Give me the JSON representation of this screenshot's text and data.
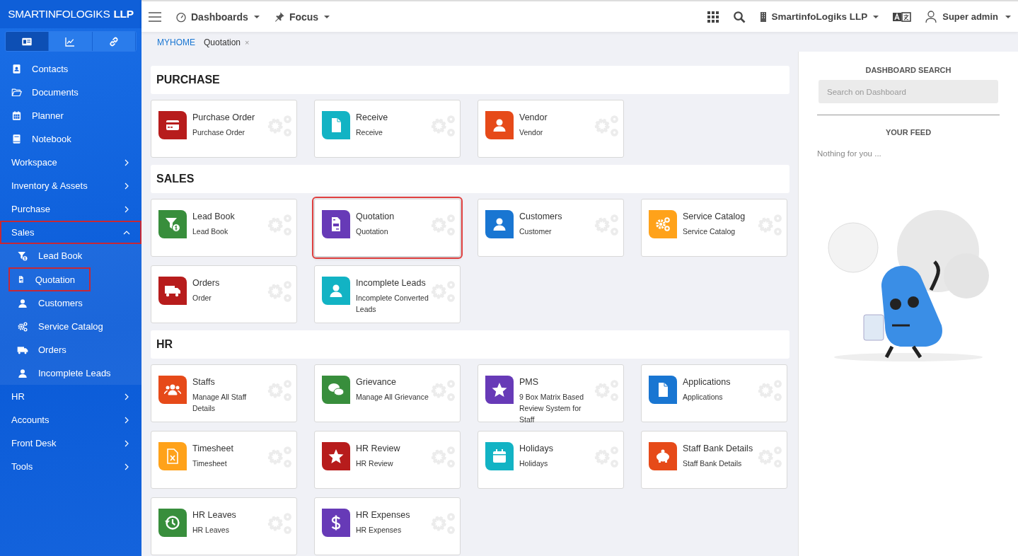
{
  "sidebar": {
    "brand": {
      "name": "SMARTINFOLOGIKS",
      "suffix": "LLP"
    },
    "tabs": [
      {
        "selected": true
      },
      {
        "selected": false
      },
      {
        "selected": false
      }
    ],
    "items": [
      {
        "kind": "link",
        "label": "Contacts"
      },
      {
        "kind": "link",
        "label": "Documents"
      },
      {
        "kind": "link",
        "label": "Planner"
      },
      {
        "kind": "link",
        "label": "Notebook"
      },
      {
        "kind": "group",
        "label": "Workspace",
        "expanded": false,
        "highlighted": false
      },
      {
        "kind": "group",
        "label": "Inventory & Assets",
        "expanded": false,
        "highlighted": false
      },
      {
        "kind": "group",
        "label": "Purchase",
        "expanded": false,
        "highlighted": false
      },
      {
        "kind": "group",
        "label": "Sales",
        "expanded": true,
        "highlighted": true,
        "children": [
          {
            "label": "Lead Book",
            "highlighted": false
          },
          {
            "label": "Quotation",
            "highlighted": true
          },
          {
            "label": "Customers",
            "highlighted": false
          },
          {
            "label": "Service Catalog",
            "highlighted": false
          },
          {
            "label": "Orders",
            "highlighted": false
          },
          {
            "label": "Incomplete Leads",
            "highlighted": false
          }
        ]
      },
      {
        "kind": "group",
        "label": "HR",
        "expanded": false,
        "highlighted": false
      },
      {
        "kind": "group",
        "label": "Accounts",
        "expanded": false,
        "highlighted": false
      },
      {
        "kind": "group",
        "label": "Front Desk",
        "expanded": false,
        "highlighted": false
      },
      {
        "kind": "group",
        "label": "Tools",
        "expanded": false,
        "highlighted": false
      }
    ]
  },
  "topbar": {
    "menus": [
      {
        "label": "Dashboards"
      },
      {
        "label": "Focus"
      }
    ],
    "company": "SmartinfoLogiks LLP",
    "user": "Super admin"
  },
  "breadcrumb": {
    "home": "MYHOME",
    "current": "Quotation",
    "close": "×"
  },
  "sections": [
    {
      "title": "PURCHASE",
      "cards": [
        {
          "title": "Purchase Order",
          "subtitle": "Purchase Order",
          "color": "#b71c1c",
          "highlighted": false
        },
        {
          "title": "Receive",
          "subtitle": "Receive",
          "color": "#12b3c4",
          "highlighted": false
        },
        {
          "title": "Vendor",
          "subtitle": "Vendor",
          "color": "#e64a19",
          "highlighted": false
        }
      ]
    },
    {
      "title": "SALES",
      "cards": [
        {
          "title": "Lead Book",
          "subtitle": "Lead Book",
          "color": "#388e3c",
          "highlighted": false
        },
        {
          "title": "Quotation",
          "subtitle": "Quotation",
          "color": "#673ab7",
          "highlighted": true
        },
        {
          "title": "Customers",
          "subtitle": "Customer",
          "color": "#1976d2",
          "highlighted": false
        },
        {
          "title": "Service Catalog",
          "subtitle": "Service Catalog",
          "color": "#ffa21a",
          "highlighted": false
        },
        {
          "title": "Orders",
          "subtitle": "Order",
          "color": "#b71c1c",
          "highlighted": false
        },
        {
          "title": "Incomplete Leads",
          "subtitle": "Incomplete Converted Leads",
          "color": "#12b3c4",
          "highlighted": false
        }
      ]
    },
    {
      "title": "HR",
      "cards": [
        {
          "title": "Staffs",
          "subtitle": "Manage All Staff Details",
          "color": "#e64a19",
          "highlighted": false
        },
        {
          "title": "Grievance",
          "subtitle": "Manage All Grievance",
          "color": "#388e3c",
          "highlighted": false
        },
        {
          "title": "PMS",
          "subtitle": "9 Box Matrix Based Review System for Staff",
          "color": "#673ab7",
          "highlighted": false
        },
        {
          "title": "Applications",
          "subtitle": "Applications",
          "color": "#1976d2",
          "highlighted": false
        },
        {
          "title": "Timesheet",
          "subtitle": "Timesheet",
          "color": "#ffa21a",
          "highlighted": false
        },
        {
          "title": "HR Review",
          "subtitle": "HR Review",
          "color": "#b71c1c",
          "highlighted": false
        },
        {
          "title": "Holidays",
          "subtitle": "Holidays",
          "color": "#12b3c4",
          "highlighted": false
        },
        {
          "title": "Staff Bank Details",
          "subtitle": "Staff Bank Details",
          "color": "#e64a19",
          "highlighted": false
        },
        {
          "title": "HR Leaves",
          "subtitle": "HR Leaves",
          "color": "#388e3c",
          "highlighted": false
        },
        {
          "title": "HR Expenses",
          "subtitle": "HR Expenses",
          "color": "#673ab7",
          "highlighted": false
        }
      ]
    }
  ],
  "right_panel": {
    "search_title": "DASHBOARD SEARCH",
    "search": {
      "placeholder": "Search on Dashboard"
    },
    "feed_title": "YOUR FEED",
    "feed_empty": "Nothing for you ..."
  }
}
